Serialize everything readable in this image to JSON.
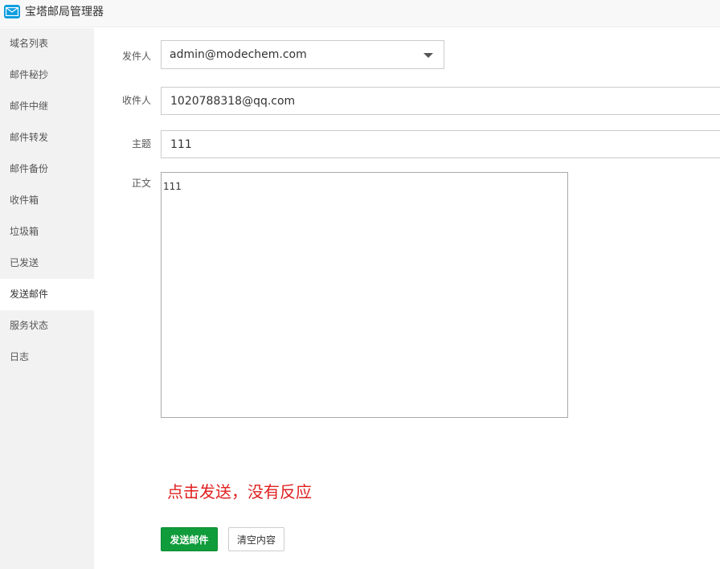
{
  "app": {
    "title": "宝塔邮局管理器",
    "icon": "mail-icon",
    "accent_color": "#0f9ee0"
  },
  "sidebar": {
    "active_index": 8,
    "items": [
      {
        "label": "域名列表"
      },
      {
        "label": "邮件秘抄"
      },
      {
        "label": "邮件中继"
      },
      {
        "label": "邮件转发"
      },
      {
        "label": "邮件备份"
      },
      {
        "label": "收件箱"
      },
      {
        "label": "垃圾箱"
      },
      {
        "label": "已发送"
      },
      {
        "label": "发送邮件"
      },
      {
        "label": "服务状态"
      },
      {
        "label": "日志"
      }
    ]
  },
  "form": {
    "sender_label": "发件人",
    "sender_value": "admin@modechem.com",
    "recipient_label": "收件人",
    "recipient_value": "1020788318@qq.com",
    "subject_label": "主题",
    "subject_value": "111",
    "body_label": "正文",
    "body_value": "111"
  },
  "annotation": {
    "text": "点击发送，没有反应",
    "color": "#e02020"
  },
  "actions": {
    "send_label": "发送邮件",
    "send_color": "#109c3a",
    "clear_label": "清空内容"
  }
}
